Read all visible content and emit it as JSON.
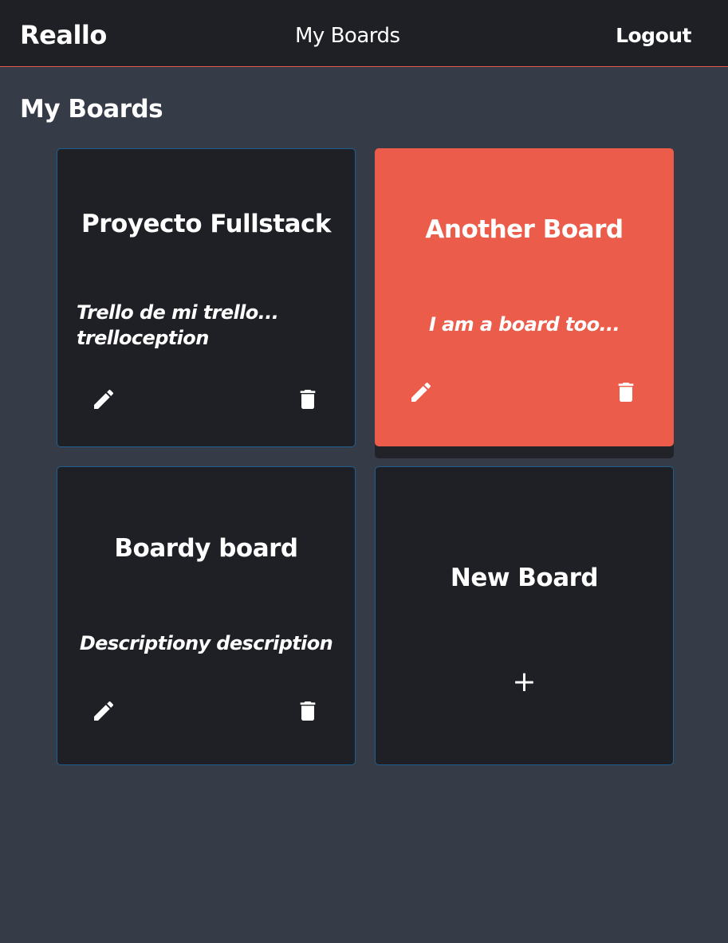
{
  "header": {
    "brand": "Reallo",
    "nav_link": "My Boards",
    "logout": "Logout"
  },
  "page": {
    "title": "My Boards"
  },
  "boards": [
    {
      "title": "Proyecto Fullstack",
      "description": "Trello de mi trello... trelloception"
    },
    {
      "title": "Another Board",
      "description": "I am a board too..."
    },
    {
      "title": "Boardy board",
      "description": "Descriptiony description"
    }
  ],
  "new_board": {
    "title": "New Board",
    "icon": "+"
  },
  "colors": {
    "navbar": "#1e2026",
    "background": "#363c47",
    "card": "#1e2026",
    "card_border": "#1f5f8f",
    "accent": "#eb5c4a"
  },
  "icons": {
    "edit": "pencil-icon",
    "delete": "trash-icon",
    "add": "plus-icon"
  }
}
